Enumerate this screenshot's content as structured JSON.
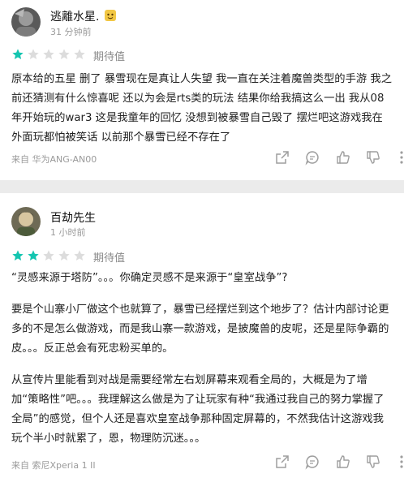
{
  "reviews": [
    {
      "name": "逃離水星.",
      "time": "31 分钟前",
      "rating": 1,
      "rating_max": 5,
      "rating_label": "期待值",
      "paragraphs": [
        "原本给的五星 删了 暴雪现在是真让人失望 我一直在关注着魔兽类型的手游 我之前还猜测有什么惊喜呢 还以为会是rts类的玩法 结果你给我搞这么一出 我从08年开始玩的war3 这是我童年的回忆 没想到被暴雪自己毁了 摆烂吧这游戏我在外面玩都怕被笑话 以前那个暴雪已经不存在了"
      ],
      "device": "来自 华为ANG-AN00"
    },
    {
      "name": "百劫先生",
      "time": "1 小时前",
      "rating": 2,
      "rating_max": 5,
      "rating_label": "期待值",
      "paragraphs": [
        "“灵感来源于塔防”。。。你确定灵感不是来源于“皇室战争”?",
        "要是个山寨小厂做这个也就算了，暴雪已经摆烂到这个地步了？估计内部讨论更多的不是怎么做游戏，而是我山寨一款游戏，是披魔兽的皮呢，还是星际争霸的皮。。。反正总会有死忠粉买单的。",
        "从宣传片里能看到对战是需要经常左右划屏幕来观看全局的，大概是为了增加“策略性”吧。。。我理解这么做是为了让玩家有种“我通过我自己的努力掌握了全局”的感觉，但个人还是喜欢皇室战争那种固定屏幕的，不然我估计这游戏我玩个半小时就累了，恩，物理防沉迷。。。"
      ],
      "device": "来自 索尼Xperia 1 II"
    }
  ],
  "colors": {
    "star_filled": "#14c5b0",
    "star_empty": "#dcdcdc",
    "page_bg": "#ebebeb",
    "card_bg": "#ffffff",
    "muted_text": "#9a9a9a"
  },
  "icons": [
    "share-icon",
    "comment-icon",
    "thumbs-up-icon",
    "thumbs-down-icon",
    "more-icon"
  ]
}
